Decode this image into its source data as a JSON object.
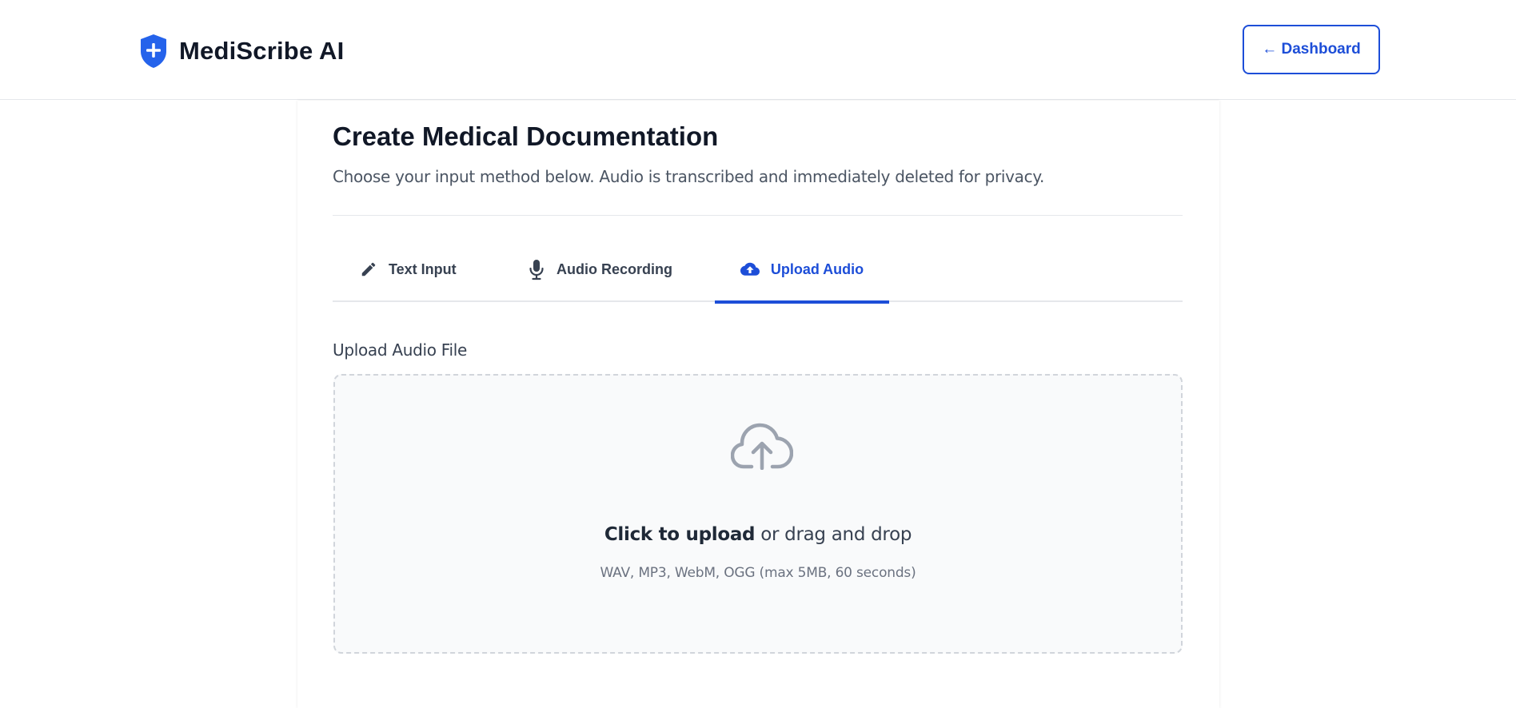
{
  "header": {
    "app_name": "MediScribe AI",
    "logo_icon": "shield-plus-icon",
    "dashboard_button": "← Dashboard"
  },
  "main": {
    "title": "Create Medical Documentation",
    "subtitle": "Choose your input method below. Audio is transcribed and immediately deleted for privacy.",
    "tabs": [
      {
        "label": "Text Input",
        "icon": "pencil-icon",
        "active": false
      },
      {
        "label": "Audio Recording",
        "icon": "microphone-icon",
        "active": false
      },
      {
        "label": "Upload Audio",
        "icon": "cloud-upload-icon",
        "active": true
      }
    ],
    "upload": {
      "section_label": "Upload Audio File",
      "cta_strong": "Click to upload",
      "cta_rest": " or drag and drop",
      "hint": "WAV, MP3, WebM, OGG (max 5MB, 60 seconds)",
      "icon": "cloud-upload-icon"
    }
  },
  "colors": {
    "accent": "#1d4ed8",
    "text_primary": "#111827",
    "text_muted": "#6b7280",
    "dropzone_bg": "#f9fafb",
    "border": "#e5e7eb"
  }
}
